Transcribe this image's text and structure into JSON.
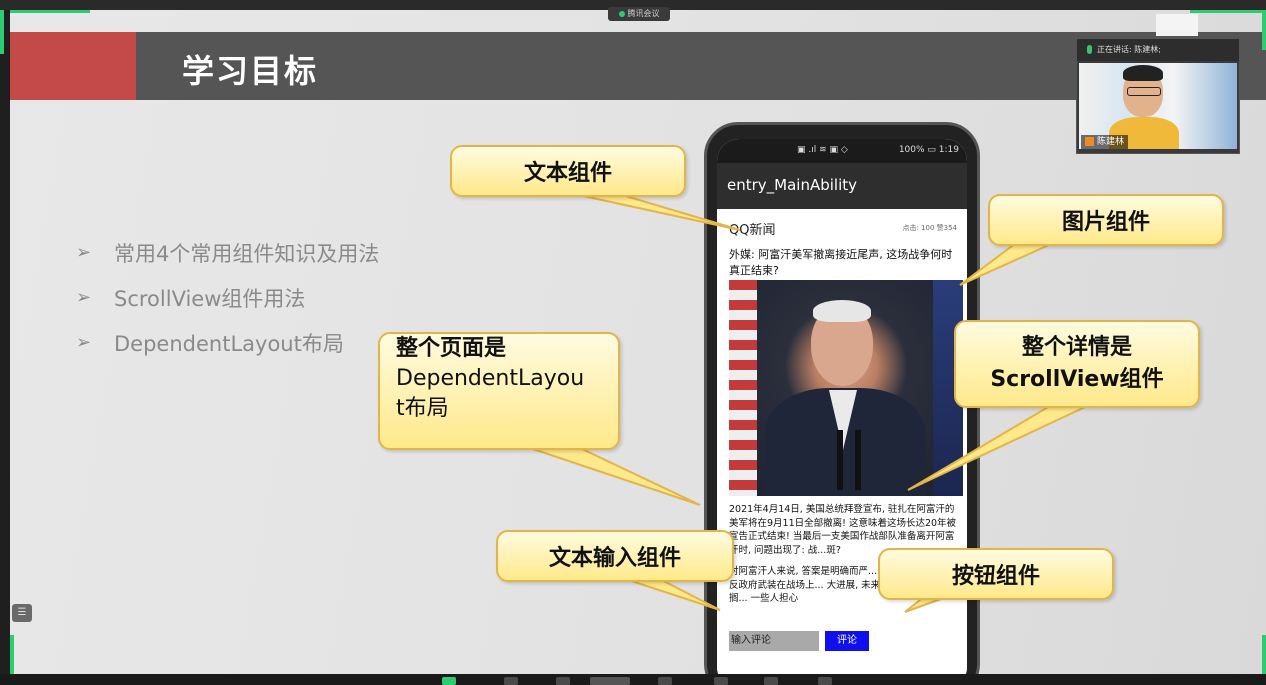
{
  "meeting": {
    "app_label": "腾讯会议"
  },
  "slide": {
    "title": "学习目标",
    "bullets": [
      {
        "marker": "➢",
        "text": "常用4个常用组件知识及用法"
      },
      {
        "marker": "➢",
        "text": "ScrollView组件用法"
      },
      {
        "marker": "➢",
        "text": "DependentLayout布局"
      }
    ]
  },
  "phone": {
    "status_right": "100% ▭ 1:19",
    "status_mid": "▣ .ıl ≋ ▣ ◇",
    "app_title": "entry_MainAbility",
    "source": "QQ新闻",
    "stats": "点击: 100  赞354",
    "headline": "外媒: 阿富汗美军撤离接近尾声, 这场战争何时真正结束?",
    "body_p1": "2021年4月14日, 美国总统拜登宣布, 驻扎在阿富汗的美军将在9月11日全部撤离! 这意味着这场长达20年被宣告正式结束! 当最后一支美国作战部队准备离开阿富汗时, 问题出现了: 战...",
    "body_p1_end": "斑?",
    "body_p2": "对阿富汗人来说, 答案是明确而严... 快。最近, 阿富汗的反政府武装在战场上... 大进展, 未来的和平谈判将会搁... 一些人担心",
    "input_placeholder": "输入评论",
    "button_label": "评论"
  },
  "callouts": {
    "text_component": "文本组件",
    "image_component": "图片组件",
    "page_layout_line1": "整个页面是",
    "page_layout_line2": "DependentLayou",
    "page_layout_line3": "t布局",
    "scroll_line1": "整个详情是",
    "scroll_line2": "ScrollView组件",
    "text_input_component": "文本输入组件",
    "button_component": "按钮组件"
  },
  "video": {
    "speaking_label": "正在讲话: 陈建林;",
    "participant_name": "陈建林"
  },
  "colors": {
    "title_bar": "#555555",
    "title_accent": "#c44a4a",
    "callout_fill": "#ffe98a",
    "callout_border": "#e3b44a",
    "button_blue": "#1010ee"
  }
}
